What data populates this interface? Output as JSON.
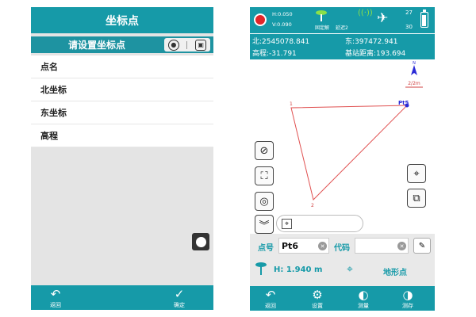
{
  "left": {
    "title": "坐标点",
    "subtitle": "请设置坐标点",
    "fields": [
      {
        "label": "点名"
      },
      {
        "label": "北坐标"
      },
      {
        "label": "东坐标"
      },
      {
        "label": "高程"
      }
    ],
    "bottom": {
      "back_label": "返回",
      "confirm_label": "确定"
    }
  },
  "right": {
    "status": {
      "h_precision": "H:0.050",
      "v_precision": "V:0.090",
      "solution": "固定解",
      "delay": "延迟2",
      "sat_used": "27",
      "sat_total": "30"
    },
    "coords": {
      "north": "北:2545078.841",
      "east": "东:397472.941",
      "elevation": "高程:-31.791",
      "base_distance": "基站距离:193.694"
    },
    "map": {
      "scale_label": "2/2m",
      "compass_label": "N",
      "vertex_labels": [
        "1",
        "2",
        "Pt5"
      ]
    },
    "panel": {
      "point_label": "点号",
      "point_value": "Pt6",
      "code_label": "代码",
      "code_value": "",
      "height_text": "H: 1.940 m",
      "point_type": "地形点"
    },
    "bottom": {
      "back_label": "返回",
      "settings_label": "设置",
      "measure_label": "测量",
      "save_label": "测存"
    }
  },
  "colors": {
    "accent": "#169aa8",
    "record": "#e0262a",
    "polyline": "#e05050",
    "point": "#2b2bd6"
  },
  "icons": {
    "left_sub": [
      "location-pin-icon",
      "map-icon"
    ],
    "map_tools": [
      "no-entry-icon",
      "fit-extent-icon",
      "locate-icon",
      "collapse-icon"
    ],
    "map_right": [
      "map-pin-icon",
      "layers-icon"
    ]
  }
}
